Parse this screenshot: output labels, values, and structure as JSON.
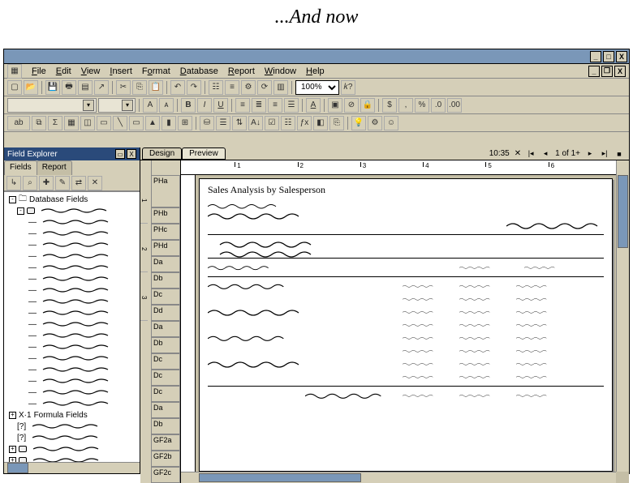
{
  "caption": "...And now",
  "menus": {
    "file": "File",
    "edit": "Edit",
    "view": "View",
    "insert": "Insert",
    "format": "Format",
    "database": "Database",
    "report": "Report",
    "window": "Window",
    "help": "Help"
  },
  "toolbar1": {
    "zoom": "100%"
  },
  "explorer": {
    "title": "Field Explorer",
    "tabs": {
      "fields": "Fields",
      "report": "Report"
    },
    "sections": {
      "db": "Database Fields",
      "formula": "Formula Fields"
    }
  },
  "design": {
    "tabs": {
      "design": "Design",
      "preview": "Preview"
    },
    "status": {
      "time": "10:35",
      "page": "1 of 1+"
    },
    "sections": {
      "pha": "PHa",
      "phb": "PHb",
      "phc": "PHc",
      "phd": "PHd",
      "da": "Da",
      "db": "Db",
      "dc": "Dc",
      "dd": "Dd",
      "gf2a": "GF2a",
      "gf2b": "GF2b",
      "gf2c": "GF2c"
    },
    "report_title": "Sales Analysis by Salesperson",
    "ruler_marks": [
      "1",
      "2",
      "3",
      "4",
      "5",
      "6"
    ]
  }
}
